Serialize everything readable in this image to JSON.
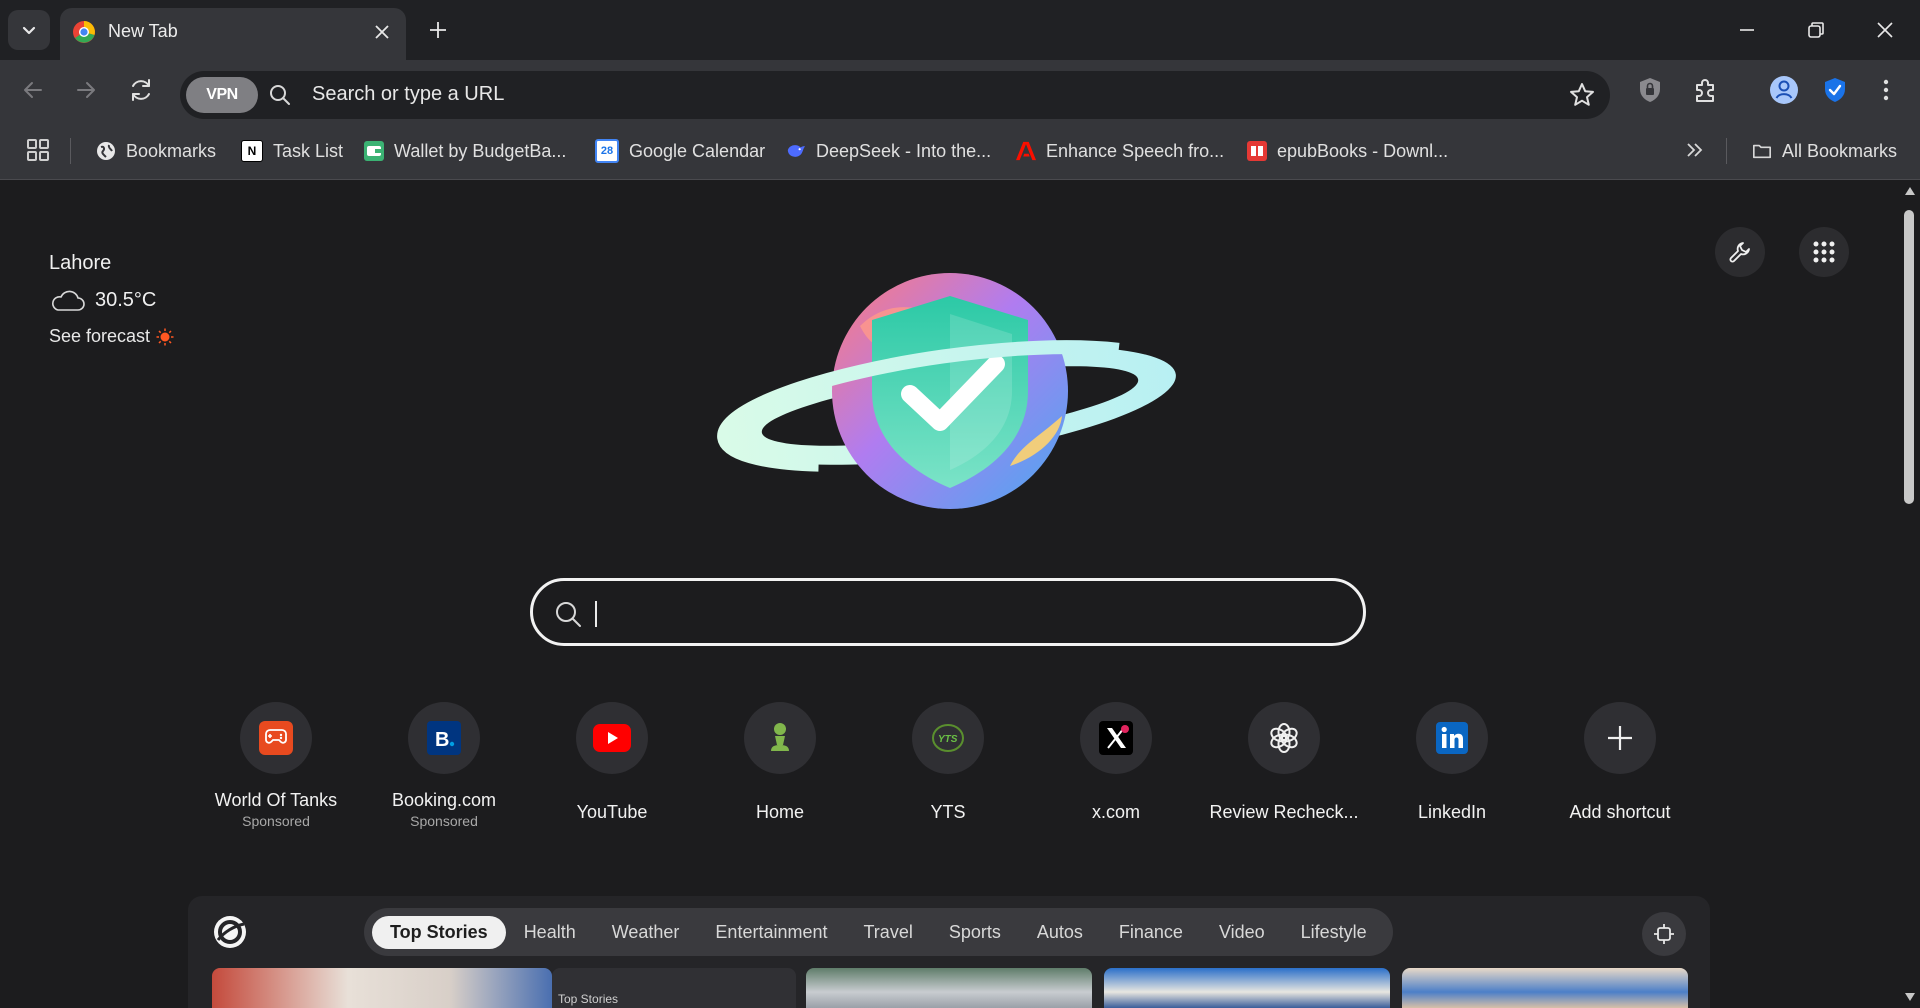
{
  "tab": {
    "title": "New Tab"
  },
  "omnibox": {
    "vpn_label": "VPN",
    "placeholder": "Search or type a URL"
  },
  "bookmarks": {
    "items": [
      {
        "label": "Bookmarks",
        "icon": "globe-icon"
      },
      {
        "label": "Task List",
        "icon": "notion-icon"
      },
      {
        "label": "Wallet by BudgetBa...",
        "icon": "wallet-icon"
      },
      {
        "label": "Google Calendar",
        "icon": "calendar-icon"
      },
      {
        "label": "DeepSeek - Into the...",
        "icon": "deepseek-icon"
      },
      {
        "label": "Enhance Speech fro...",
        "icon": "adobe-icon"
      },
      {
        "label": "epubBooks - Downl...",
        "icon": "epubbooks-icon"
      }
    ],
    "all_bookmarks": "All Bookmarks"
  },
  "weather": {
    "city": "Lahore",
    "temp": "30.5°C",
    "forecast_link": "See forecast"
  },
  "shortcuts": [
    {
      "label": "World Of Tanks",
      "sub": "Sponsored",
      "icon": "game-icon"
    },
    {
      "label": "Booking.com",
      "sub": "Sponsored",
      "icon": "booking-icon"
    },
    {
      "label": "YouTube",
      "icon": "youtube-icon"
    },
    {
      "label": "Home",
      "icon": "chess-pawn-icon"
    },
    {
      "label": "YTS",
      "icon": "yts-icon"
    },
    {
      "label": "x.com",
      "icon": "x-icon"
    },
    {
      "label": "Review Recheck...",
      "icon": "openai-icon"
    },
    {
      "label": "LinkedIn",
      "icon": "linkedin-icon"
    },
    {
      "label": "Add shortcut",
      "icon": "plus-icon"
    }
  ],
  "news": {
    "tabs": [
      "Top Stories",
      "Health",
      "Weather",
      "Entertainment",
      "Travel",
      "Sports",
      "Autos",
      "Finance",
      "Video",
      "Lifestyle"
    ],
    "active_tab": "Top Stories",
    "card_label": "Top Stories"
  },
  "colors": {
    "accent_blue": "#1a73e8",
    "background": "#1c1c1e",
    "toolbar": "#35363a"
  }
}
